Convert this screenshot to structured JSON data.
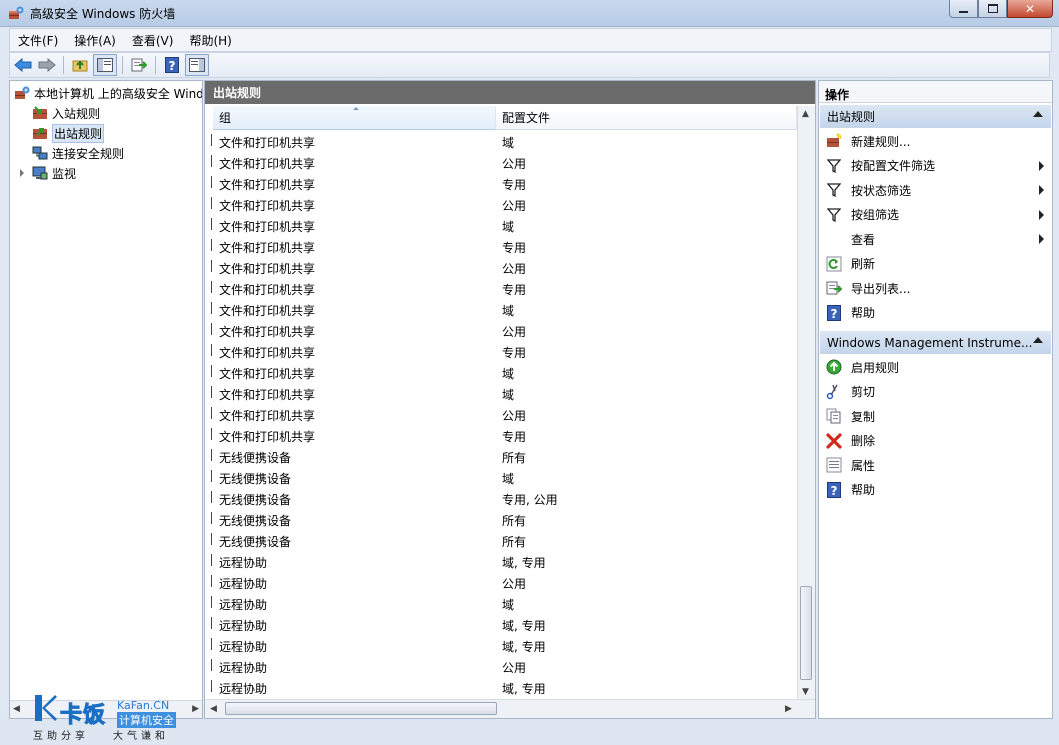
{
  "window": {
    "title": "高级安全 Windows 防火墙"
  },
  "menu": [
    "文件(F)",
    "操作(A)",
    "查看(V)",
    "帮助(H)"
  ],
  "tree": {
    "root": "本地计算机 上的高级安全 Windows 防火墙",
    "items": [
      "入站规则",
      "出站规则",
      "连接安全规则",
      "监视"
    ]
  },
  "middle": {
    "header": "出站规则",
    "columns": [
      "组",
      "配置文件"
    ],
    "rows": [
      {
        "group": "文件和打印机共享",
        "profile": "域"
      },
      {
        "group": "文件和打印机共享",
        "profile": "公用"
      },
      {
        "group": "文件和打印机共享",
        "profile": "专用"
      },
      {
        "group": "文件和打印机共享",
        "profile": "公用"
      },
      {
        "group": "文件和打印机共享",
        "profile": "域"
      },
      {
        "group": "文件和打印机共享",
        "profile": "专用"
      },
      {
        "group": "文件和打印机共享",
        "profile": "公用"
      },
      {
        "group": "文件和打印机共享",
        "profile": "专用"
      },
      {
        "group": "文件和打印机共享",
        "profile": "域"
      },
      {
        "group": "文件和打印机共享",
        "profile": "公用"
      },
      {
        "group": "文件和打印机共享",
        "profile": "专用"
      },
      {
        "group": "文件和打印机共享",
        "profile": "域"
      },
      {
        "group": "文件和打印机共享",
        "profile": "域"
      },
      {
        "group": "文件和打印机共享",
        "profile": "公用"
      },
      {
        "group": "文件和打印机共享",
        "profile": "专用"
      },
      {
        "group": "无线便携设备",
        "profile": "所有"
      },
      {
        "group": "无线便携设备",
        "profile": "域"
      },
      {
        "group": "无线便携设备",
        "profile": "专用, 公用"
      },
      {
        "group": "无线便携设备",
        "profile": "所有"
      },
      {
        "group": "无线便携设备",
        "profile": "所有"
      },
      {
        "group": "远程协助",
        "profile": "域, 专用"
      },
      {
        "group": "远程协助",
        "profile": "公用"
      },
      {
        "group": "远程协助",
        "profile": "域"
      },
      {
        "group": "远程协助",
        "profile": "域, 专用"
      },
      {
        "group": "远程协助",
        "profile": "域, 专用"
      },
      {
        "group": "远程协助",
        "profile": "公用"
      },
      {
        "group": "远程协助",
        "profile": "域, 专用"
      }
    ]
  },
  "actions": {
    "title": "操作",
    "section1": "出站规则",
    "section1_items": [
      {
        "label": "新建规则...",
        "icon": "new-rule-icon",
        "submenu": false
      },
      {
        "label": "按配置文件筛选",
        "icon": "filter-icon",
        "submenu": true
      },
      {
        "label": "按状态筛选",
        "icon": "filter-icon",
        "submenu": true
      },
      {
        "label": "按组筛选",
        "icon": "filter-icon",
        "submenu": true
      },
      {
        "label": "查看",
        "icon": "",
        "submenu": true
      },
      {
        "label": "刷新",
        "icon": "refresh-icon",
        "submenu": false
      },
      {
        "label": "导出列表...",
        "icon": "export-icon",
        "submenu": false
      },
      {
        "label": "帮助",
        "icon": "help-icon",
        "submenu": false
      }
    ],
    "section2": "Windows Management Instrume...",
    "section2_items": [
      {
        "label": "启用规则",
        "icon": "enable-icon"
      },
      {
        "label": "剪切",
        "icon": "cut-icon"
      },
      {
        "label": "复制",
        "icon": "copy-icon"
      },
      {
        "label": "删除",
        "icon": "delete-icon"
      },
      {
        "label": "属性",
        "icon": "properties-icon"
      },
      {
        "label": "帮助",
        "icon": "help-icon"
      }
    ]
  },
  "watermark": {
    "brand": "卡饭",
    "domain": "KaFan.CN",
    "tagline": "计算机安全",
    "slogan_left": "互助分享",
    "slogan_right": "大气谦和"
  }
}
